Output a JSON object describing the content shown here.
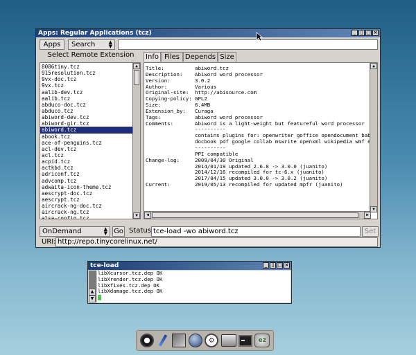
{
  "apps_window": {
    "title": "Apps: Regular Applications (tcz)",
    "apps_button": "Apps",
    "search_button": "Search",
    "search_value": "",
    "list_heading": "Select Remote Extension",
    "extensions": [
      "8086tiny.tcz",
      "915resolution.tcz",
      "9vx-doc.tcz",
      "9vx.tcz",
      "aalib-dev.tcz",
      "aalib.tcz",
      "abduco-doc.tcz",
      "abduco.tcz",
      "abiword-dev.tcz",
      "abiword-gir.tcz",
      "abiword.tcz",
      "abook.tcz",
      "ace-of-penguins.tcz",
      "acl-dev.tcz",
      "acl.tcz",
      "acpid.tcz",
      "actkbd.tcz",
      "adriconf.tcz",
      "advcomp.tcz",
      "adwaita-icon-theme.tcz",
      "aescrypt-doc.tcz",
      "aescrypt.tcz",
      "aircrack-ng-doc.tcz",
      "aircrack-ng.tcz",
      "alsa-config.tcz"
    ],
    "selected_index": 10,
    "tabs": [
      "Info",
      "Files",
      "Depends",
      "Size"
    ],
    "active_tab": 0,
    "info_rows": [
      [
        "Title:",
        "abiword.tcz"
      ],
      [
        "Description:",
        "Abiword word processor"
      ],
      [
        "Version:",
        "3.0.2"
      ],
      [
        "Author:",
        "Various"
      ],
      [
        "Original-site:",
        "http://abisource.com"
      ],
      [
        "Copying-policy:",
        "GPL2"
      ],
      [
        "Size:",
        "6.4MB"
      ],
      [
        "Extension_by:",
        "Curaga"
      ],
      [
        "Tags:",
        "abiword word processor"
      ],
      [
        "Comments:",
        "Abiword is a light-weight but featureful word processor"
      ],
      [
        "",
        "----------"
      ],
      [
        "",
        "contains plugins for: openwriter goffice opendocument babelfi"
      ],
      [
        "",
        "docbook pdf google collab mswrite openxml wikipedia wmf epub"
      ],
      [
        "",
        "----------"
      ],
      [
        "",
        "PPI compatible"
      ],
      [
        "Change-log:",
        "2009/04/30 Original"
      ],
      [
        "",
        "2014/01/19 updated 2.6.8 -> 3.0.0 (juanito)"
      ],
      [
        "",
        "2014/12/16 recompiled for tc-6.x (juanito)"
      ],
      [
        "",
        "2017/04/15 updated 3.0.0 -> 3.0.2 (juanito)"
      ],
      [
        "Current:",
        "2019/05/13 recompiled for updated mpfr (juanito)"
      ]
    ],
    "mode_select": "OnDemand",
    "go_button": "Go",
    "status_label": "Status",
    "status_value": "tce-load -wo abiword.tcz",
    "set_button": "Set",
    "uri_label": "URI:",
    "uri_value": "http://repo.tinycorelinux.net/"
  },
  "tce_window": {
    "title": "tce-load",
    "lines": [
      "libXcursor.tcz.dep OK",
      "libXrender.tcz.dep OK",
      "libXfixes.tcz.dep OK",
      "libXdamage.tcz.dep OK"
    ]
  },
  "dock": {
    "icons": [
      "power-icon",
      "editor-pen-icon",
      "apps-icon",
      "mount-icon",
      "network-icon",
      "control-panel-icon",
      "terminal-icon",
      "ezremaster-icon"
    ]
  },
  "colors": {
    "selection": "#1f2c7a",
    "titlebar": "#1c3f74",
    "desktop_top": "#1f5f86"
  }
}
